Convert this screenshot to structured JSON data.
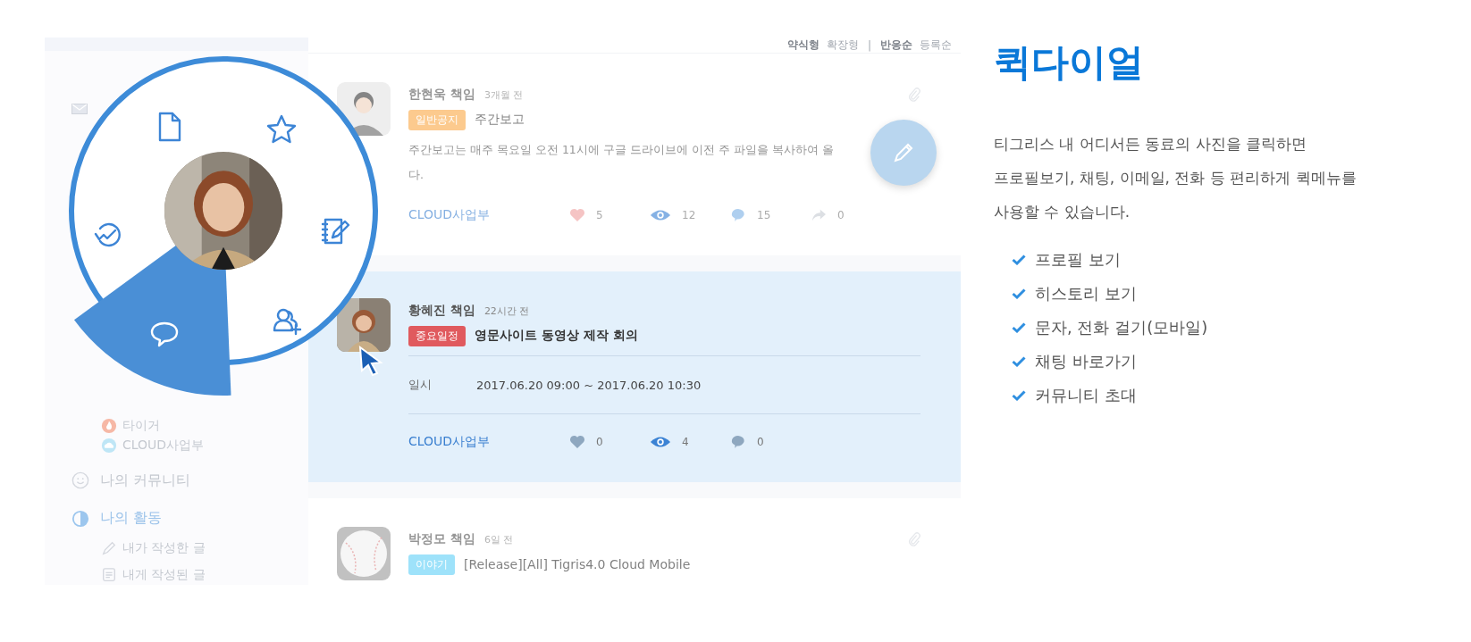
{
  "sidebar": {
    "items": [
      {
        "kind": "mail"
      },
      {
        "kind": "fire",
        "label": "타이거"
      },
      {
        "kind": "cloud",
        "label": "CLOUD사업부"
      },
      {
        "kind": "smile",
        "label": "나의 커뮤니티"
      },
      {
        "kind": "pie",
        "label": "나의 활동",
        "selected": true
      },
      {
        "kind": "pencil",
        "label": "내가 작성한 글"
      },
      {
        "kind": "note",
        "label": "내게 작성된 글"
      }
    ]
  },
  "feed": {
    "view_modes": [
      {
        "label": "약식형",
        "selected": true
      },
      {
        "label": "확장형",
        "selected": false
      }
    ],
    "separator": "|",
    "sort_orders": [
      {
        "label": "반응순",
        "selected": true
      },
      {
        "label": "등록순",
        "selected": false
      }
    ],
    "posts": [
      {
        "selected": false,
        "author": "한현욱 책임",
        "time": "3개월 전",
        "tag": "일반공지",
        "color": "#fcca8e",
        "title": "주간보고",
        "body": "주간보고는 매주 목요일 오전 11시에 구글 드라이브에 이전 주 파일을 복사하여 올\n다.",
        "attachment": true,
        "group": "CLOUD사업부",
        "stats": [
          {
            "kind": "heart",
            "count": "5"
          },
          {
            "kind": "eye",
            "count": "12"
          },
          {
            "kind": "comment",
            "count": "15"
          },
          {
            "kind": "share",
            "count": "0"
          }
        ]
      },
      {
        "selected": true,
        "author": "황혜진 책임",
        "time": "22시간 전",
        "tag": "중요일정",
        "color": "#e05a5e",
        "title": "영문사이트 동영상 제작 회의",
        "fields": [
          {
            "label": "일시",
            "value": "2017.06.20 09:00 ~ 2017.06.20 10:30"
          }
        ],
        "attachment": false,
        "group": "CLOUD사업부",
        "stats": [
          {
            "kind": "heart",
            "count": "0"
          },
          {
            "kind": "eye",
            "count": "4"
          },
          {
            "kind": "comment",
            "count": "0"
          }
        ]
      },
      {
        "selected": false,
        "author": "박정모 책임",
        "time": "6일 전",
        "tag": "이야기",
        "color": "#9ee2fa",
        "title": "[Release][All] Tigris4.0 Cloud Mobile",
        "attachment": true
      }
    ]
  },
  "quick_dial": {
    "actions": [
      {
        "kind": "document",
        "selected": false
      },
      {
        "kind": "star",
        "selected": false
      },
      {
        "kind": "note-edit",
        "selected": false
      },
      {
        "kind": "add-user",
        "selected": false
      },
      {
        "kind": "chat",
        "selected": true
      },
      {
        "kind": "history",
        "selected": false
      }
    ]
  },
  "feature": {
    "title": "퀵다이얼",
    "description": "티그리스 내 어디서든 동료의 사진을 클릭하면\n프로필보기, 채팅, 이메일, 전화 등 편리하게 퀵메뉴를\n사용할 수 있습니다.",
    "checklist": [
      "프로필 보기",
      "히스토리 보기",
      "문자, 전화 걸기(모바일)",
      "채팅 바로가기",
      "커뮤니티 초대"
    ]
  }
}
